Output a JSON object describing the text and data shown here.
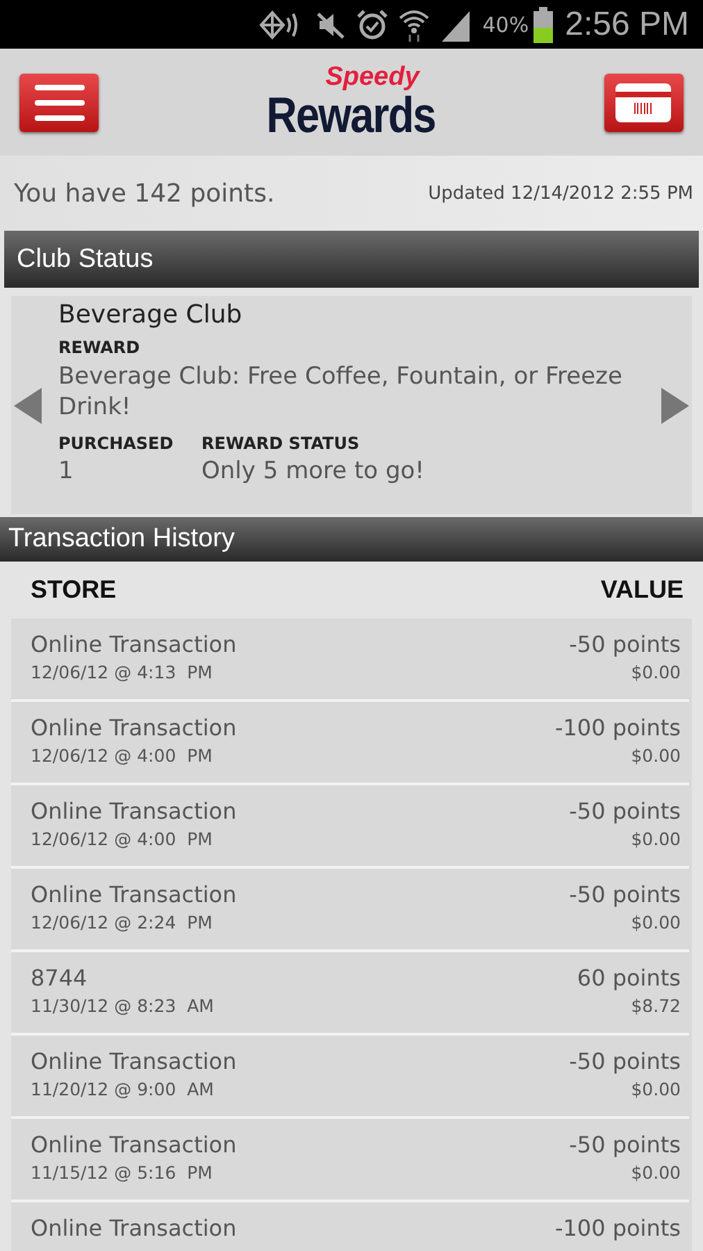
{
  "status_bar": {
    "battery": "40%",
    "time": "2:56 PM"
  },
  "header": {
    "logo_top": "Speedy",
    "logo_bottom": "Rewards"
  },
  "points": {
    "text": "You have 142 points.",
    "updated": "Updated 12/14/2012 2:55 PM"
  },
  "club_status": {
    "title": "Club Status",
    "club": "Beverage Club",
    "reward_label": "REWARD",
    "reward": "Beverage Club: Free Coffee, Fountain, or Freeze Drink!",
    "purchased_label": "PURCHASED",
    "purchased": "1",
    "status_label": "REWARD STATUS",
    "status": "Only 5 more to go!"
  },
  "transactions": {
    "title": "Transaction History",
    "columns": [
      "STORE",
      "VALUE"
    ],
    "rows": [
      {
        "store": "Online Transaction",
        "date": "12/06/12 @ 4:13  PM",
        "points": "-50 points",
        "amount": "$0.00"
      },
      {
        "store": "Online Transaction",
        "date": "12/06/12 @ 4:00  PM",
        "points": "-100 points",
        "amount": "$0.00"
      },
      {
        "store": "Online Transaction",
        "date": "12/06/12 @ 4:00  PM",
        "points": "-50 points",
        "amount": "$0.00"
      },
      {
        "store": "Online Transaction",
        "date": "12/06/12 @ 2:24  PM",
        "points": "-50 points",
        "amount": "$0.00"
      },
      {
        "store": "8744",
        "date": "11/30/12 @ 8:23  AM",
        "points": "60 points",
        "amount": "$8.72"
      },
      {
        "store": "Online Transaction",
        "date": "11/20/12 @ 9:00  AM",
        "points": "-50 points",
        "amount": "$0.00"
      },
      {
        "store": "Online Transaction",
        "date": "11/15/12 @ 5:16  PM",
        "points": "-50 points",
        "amount": "$0.00"
      },
      {
        "store": "Online Transaction",
        "points": "-100 points"
      }
    ]
  }
}
